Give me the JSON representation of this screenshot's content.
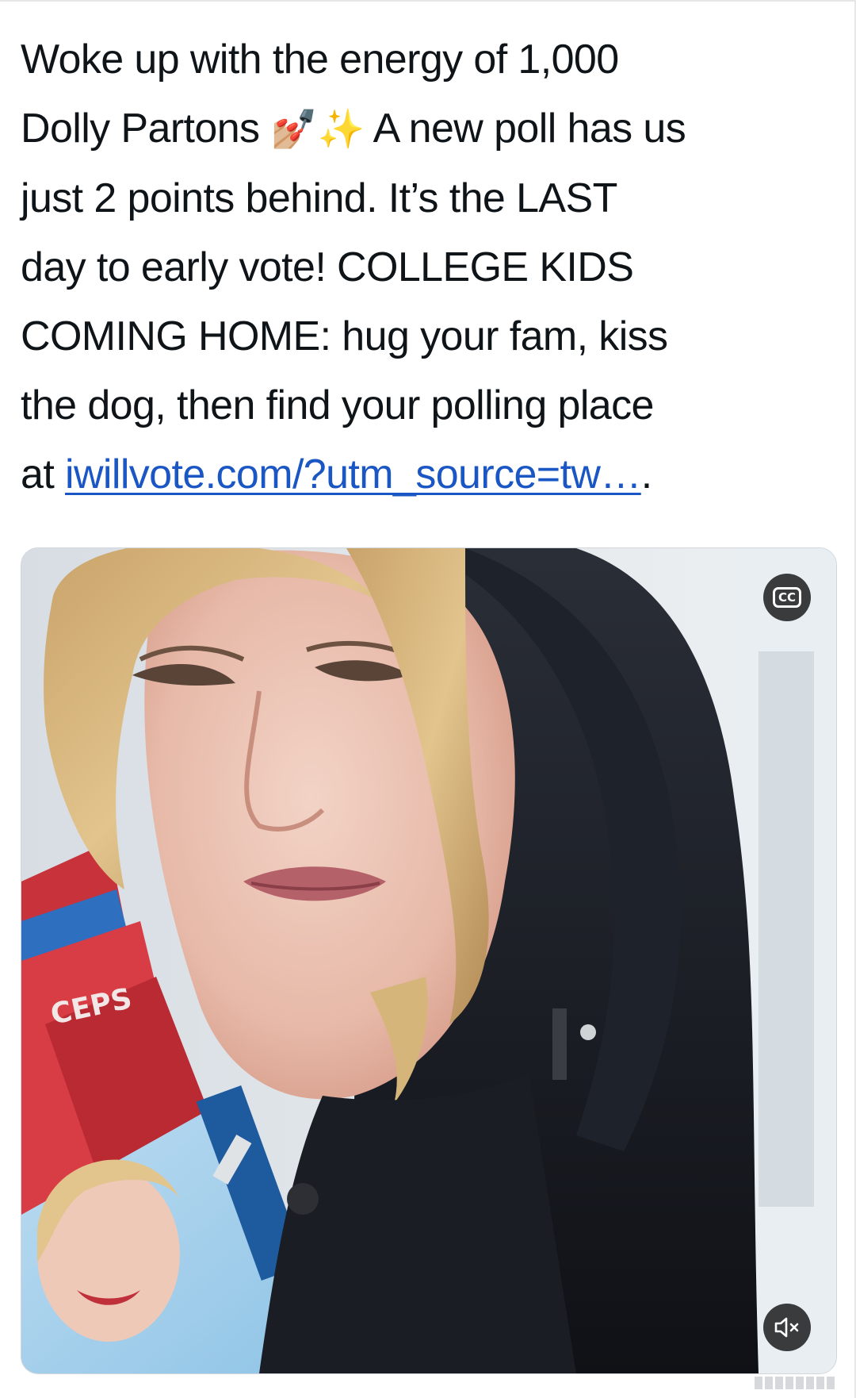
{
  "tweet": {
    "line1": "Woke up with the energy of 1,000",
    "line2_a": "Dolly Partons ",
    "emoji_nails": "💅🏼",
    "emoji_sparkles": "✨",
    "line2_b": " A new poll has us",
    "line3": "just 2 points behind. It’s the LAST",
    "line4": "day to early vote! COLLEGE KIDS",
    "line5": "COMING HOME: hug your fam, kiss",
    "line6": "the dog, then find your polling place",
    "line7_prefix": "at ",
    "link_text": "iwillvote.com/?utm_source=tw…",
    "line7_suffix": "."
  },
  "video": {
    "cc_label": "CC",
    "cc_icon": "closed-captions-icon",
    "mute_icon": "speaker-muted-icon"
  },
  "colors": {
    "link": "#1a56c4",
    "text": "#0f1419",
    "control_bg": "#141414"
  }
}
